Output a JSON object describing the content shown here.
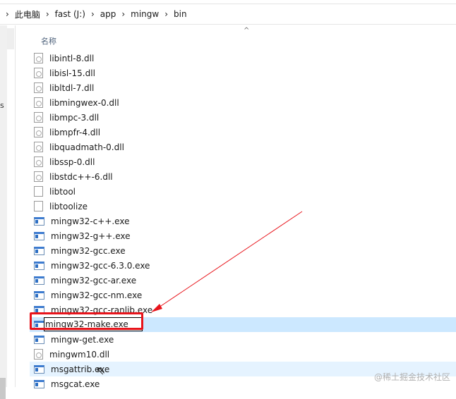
{
  "breadcrumb": [
    "此电脑",
    "fast (J:)",
    "app",
    "mingw",
    "bin"
  ],
  "column_header": "名称",
  "left_pane_letter": "s",
  "files": [
    {
      "name": "libintl-8.dll",
      "type": "dll"
    },
    {
      "name": "libisl-15.dll",
      "type": "dll"
    },
    {
      "name": "libltdl-7.dll",
      "type": "dll"
    },
    {
      "name": "libmingwex-0.dll",
      "type": "dll"
    },
    {
      "name": "libmpc-3.dll",
      "type": "dll"
    },
    {
      "name": "libmpfr-4.dll",
      "type": "dll"
    },
    {
      "name": "libquadmath-0.dll",
      "type": "dll"
    },
    {
      "name": "libssp-0.dll",
      "type": "dll"
    },
    {
      "name": "libstdc++-6.dll",
      "type": "dll"
    },
    {
      "name": "libtool",
      "type": "file"
    },
    {
      "name": "libtoolize",
      "type": "file"
    },
    {
      "name": "mingw32-c++.exe",
      "type": "exe"
    },
    {
      "name": "mingw32-g++.exe",
      "type": "exe"
    },
    {
      "name": "mingw32-gcc.exe",
      "type": "exe"
    },
    {
      "name": "mingw32-gcc-6.3.0.exe",
      "type": "exe"
    },
    {
      "name": "mingw32-gcc-ar.exe",
      "type": "exe"
    },
    {
      "name": "mingw32-gcc-nm.exe",
      "type": "exe"
    },
    {
      "name": "mingw32-gcc-ranlib.exe",
      "type": "exe"
    },
    {
      "name": "mingw32-make.exe",
      "type": "exe",
      "state": "renaming"
    },
    {
      "name": "mingw-get.exe",
      "type": "exe"
    },
    {
      "name": "mingwm10.dll",
      "type": "dll"
    },
    {
      "name": "msgattrib.exe",
      "type": "exe",
      "state": "hover"
    },
    {
      "name": "msgcat.exe",
      "type": "exe"
    }
  ],
  "watermark": "@稀土掘金技术社区",
  "colors": {
    "selected": "#cce8ff",
    "hover": "#e5f3ff",
    "annotation": "#e8141b"
  }
}
